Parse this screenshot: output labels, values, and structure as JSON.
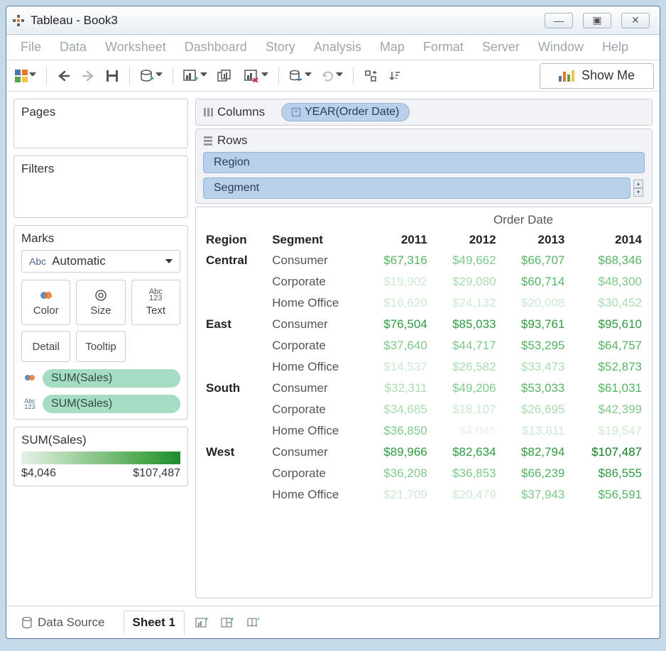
{
  "window": {
    "title": "Tableau - Book3"
  },
  "menus": [
    "File",
    "Data",
    "Worksheet",
    "Dashboard",
    "Story",
    "Analysis",
    "Map",
    "Format",
    "Server",
    "Window",
    "Help"
  ],
  "showme": "Show Me",
  "panels": {
    "pages": "Pages",
    "filters": "Filters",
    "marks": "Marks",
    "marks_select": "Automatic"
  },
  "mark_cards": {
    "color": "Color",
    "size": "Size",
    "text": "Text",
    "detail": "Detail",
    "tooltip": "Tooltip"
  },
  "pills": {
    "sum1": "SUM(Sales)",
    "sum2": "SUM(Sales)"
  },
  "legend": {
    "title": "SUM(Sales)",
    "min": "$4,046",
    "max": "$107,487"
  },
  "shelves": {
    "columns_label": "Columns",
    "rows_label": "Rows",
    "col_field": "YEAR(Order Date)",
    "row_field1": "Region",
    "row_field2": "Segment"
  },
  "viz": {
    "title": "Order Date",
    "headers": {
      "region": "Region",
      "segment": "Segment"
    },
    "years": [
      "2011",
      "2012",
      "2013",
      "2014"
    ],
    "rows": [
      {
        "region": "Central",
        "segment": "Consumer",
        "vals": [
          "$67,316",
          "$49,662",
          "$66,707",
          "$68,346"
        ],
        "shades": [
          2,
          3,
          2,
          2
        ]
      },
      {
        "region": "",
        "segment": "Corporate",
        "vals": [
          "$19,902",
          "$29,080",
          "$60,714",
          "$48,300"
        ],
        "shades": [
          5,
          4,
          2,
          3
        ]
      },
      {
        "region": "",
        "segment": "Home Office",
        "vals": [
          "$16,620",
          "$24,132",
          "$20,008",
          "$30,452"
        ],
        "shades": [
          5,
          5,
          5,
          4
        ]
      },
      {
        "region": "East",
        "segment": "Consumer",
        "vals": [
          "$76,504",
          "$85,033",
          "$93,761",
          "$95,610"
        ],
        "shades": [
          1,
          1,
          1,
          1
        ]
      },
      {
        "region": "",
        "segment": "Corporate",
        "vals": [
          "$37,640",
          "$44,717",
          "$53,295",
          "$64,757"
        ],
        "shades": [
          3,
          3,
          2,
          2
        ]
      },
      {
        "region": "",
        "segment": "Home Office",
        "vals": [
          "$14,537",
          "$26,582",
          "$33,473",
          "$52,873"
        ],
        "shades": [
          5,
          4,
          4,
          2
        ]
      },
      {
        "region": "South",
        "segment": "Consumer",
        "vals": [
          "$32,311",
          "$49,206",
          "$53,033",
          "$61,031"
        ],
        "shades": [
          4,
          3,
          2,
          2
        ]
      },
      {
        "region": "",
        "segment": "Corporate",
        "vals": [
          "$34,685",
          "$18,107",
          "$26,695",
          "$42,399"
        ],
        "shades": [
          4,
          5,
          4,
          3
        ]
      },
      {
        "region": "",
        "segment": "Home Office",
        "vals": [
          "$36,850",
          "$4,046",
          "$13,811",
          "$19,547"
        ],
        "shades": [
          3,
          6,
          5,
          5
        ]
      },
      {
        "region": "West",
        "segment": "Consumer",
        "vals": [
          "$89,966",
          "$82,634",
          "$82,794",
          "$107,487"
        ],
        "shades": [
          1,
          1,
          1,
          0
        ]
      },
      {
        "region": "",
        "segment": "Corporate",
        "vals": [
          "$36,208",
          "$36,853",
          "$66,239",
          "$86,555"
        ],
        "shades": [
          3,
          3,
          2,
          1
        ]
      },
      {
        "region": "",
        "segment": "Home Office",
        "vals": [
          "$21,709",
          "$20,479",
          "$37,943",
          "$56,591"
        ],
        "shades": [
          5,
          5,
          3,
          2
        ]
      }
    ]
  },
  "tabs": {
    "datasource": "Data Source",
    "sheet": "Sheet 1"
  }
}
